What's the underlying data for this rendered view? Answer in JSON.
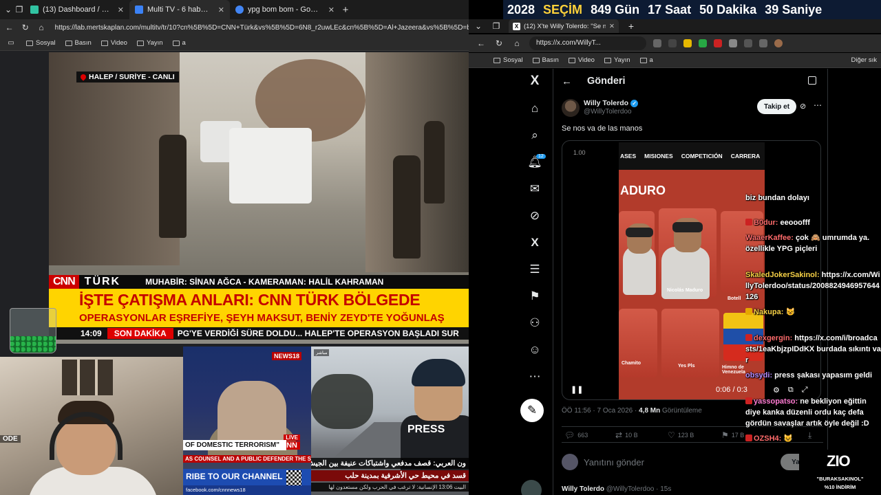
{
  "left_browser": {
    "tabs": [
      {
        "label": "(13) Dashboard / Streamlabs",
        "color": "#31c3a2"
      },
      {
        "label": "Multi TV - 6 haber kanalını ay",
        "color": "#3b82f6"
      },
      {
        "label": "ypg bom bom - Google Earth",
        "color": "#4285f4"
      }
    ],
    "url": "https://lab.mertskaplan.com/multitv/tr/10?cn%5B%5D=CNN+Türk&vs%5B%5D=6N8_r2uwLEc&cn%5B%5D=Al+Jazeera&vs%5B%5D=bNyUyr",
    "bookmarks": [
      "Sosyal",
      "Basın",
      "Video",
      "Yayın",
      "a"
    ]
  },
  "cnn": {
    "location": "HALEP / SURİYE - CANLI",
    "logo": "CNN",
    "logo_suffix": "TÜRK",
    "credits": "MUHABİR: SİNAN AĞCA - KAMERAMAN: HALİL KAHRAMAN",
    "headline": "İŞTE ÇATIŞMA ANLARI: CNN TÜRK BÖLGEDE",
    "subheadline": "OPERASYONLAR EŞREFİYE, ŞEYH MAKSUT, BENİY ZEYD'TE YOĞUNLAŞ",
    "time": "14:09",
    "breaking": "SON DAKİKA",
    "ticker": "PG'YE VERDİĞİ SÜRE DOLDU... HALEP'TE OPERASYON BAŞLADI   SUR"
  },
  "webcam": {
    "mode_label": "ODE"
  },
  "news18": {
    "logo": "NEWS18",
    "live": "LIVE",
    "cnn": "CNN",
    "caption": "OF DOMESTIC TERRORISM\"",
    "caption2": "AS COUNSEL AND A PUBLIC DEFENDER THE SOURCE",
    "subscribe": "RIBE TO OUR CHANNEL",
    "social": "facebook.com/cnnnews18"
  },
  "aljazeera": {
    "tag": "مباشر",
    "caption1": "ون العربي: قصف مدفعي واشتباكات عنيفة بين الجيش",
    "caption2": "قسد في محيط حي الأشرفية بمدينة حلب",
    "caption3": "البيت 13:06 الإنسانية: لا ترغب في الحرب ولكن مستعدون لها",
    "press": "PRESS"
  },
  "countdown": {
    "year": "2028",
    "label": "SEÇİM",
    "days": "849 Gün",
    "hours": "17 Saat",
    "minutes": "50 Dakika",
    "seconds": "39 Saniye"
  },
  "right_browser": {
    "tab_label": "(12) X'te Willy Tolerdo: \"Se no",
    "url": "https://x.com/WillyT...",
    "bookmarks": [
      "Sosyal",
      "Basın",
      "Video",
      "Yayın",
      "a"
    ],
    "other_bookmarks": "Diğer sık"
  },
  "x": {
    "header_title": "Gönderi",
    "notif_badge": "12",
    "author_name": "Willy Tolerdo",
    "author_handle": "@WillyTolerdoo",
    "follow_label": "Takip et",
    "post_text": "Se nos va de las manos",
    "video_speed": "1.00",
    "game_tabs": [
      "ASES",
      "MISIONES",
      "COMPETICIÓN",
      "CARRERA"
    ],
    "game_title": "ADURO",
    "card_labels": [
      "Nicolás Maduro",
      "Botell",
      "Chamito",
      "Yes Pls",
      "Himno de Venezuela"
    ],
    "video_time": "0:06 / 0:3",
    "timestamp": "ÖÖ 11:56 · 7 Oca 2026 · ",
    "views_count": "4,8 Mn",
    "views_label": " Görüntüleme",
    "replies": "663",
    "reposts": "10 B",
    "likes": "123 B",
    "bookmarks": "17 B",
    "reply_placeholder": "Yanıtını gönder",
    "reply_button": "Yan",
    "next_post_name": "Willy Tolerdo",
    "next_post_meta": " @WillyTolerdoo · 15s"
  },
  "chat": [
    {
      "user": "",
      "text": "biz bundan dolayı"
    },
    {
      "user": "B0dur:",
      "text": " eeooofff"
    },
    {
      "user": "WaaerKaffee:",
      "text": " çok 🙈 umrumda ya. özellikle YPG piçleri"
    },
    {
      "user": "SkaledJokerSakinol:",
      "text": " https://x.com/WillyTolerdoo/status/2008824946957644126"
    },
    {
      "user": "Nakupa:",
      "text": " 😺"
    },
    {
      "user": "dexgergin:",
      "text": " https://x.com/i/broadcasts/1eaKbjzpIDdKX burdada sıkıntı var"
    },
    {
      "user": "obsydi:",
      "text": " press şakası yapasım geldi"
    },
    {
      "user": "yassopatso:",
      "text": " ne bekliyon eğittin diye kanka düzenli ordu kaç defa gördün savaşlar artık öyle değil :D"
    },
    {
      "user": "OZSH4:",
      "text": " 😺"
    }
  ],
  "promo": {
    "brand": "ZIO",
    "line1": "\"BURAKSAKINOL\"",
    "line2": "%10 İNDİRİM"
  }
}
